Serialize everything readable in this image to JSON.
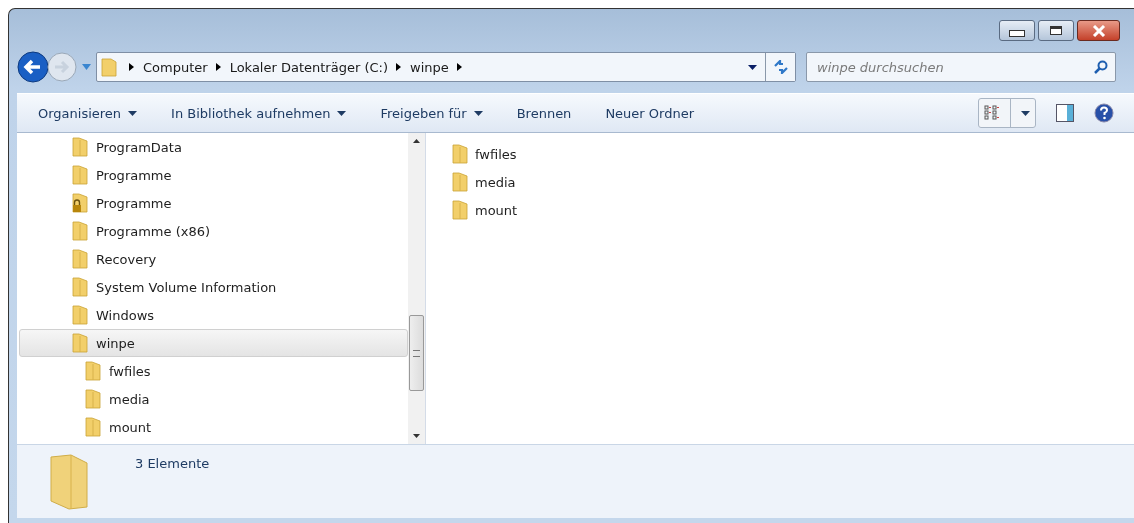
{
  "address": {
    "crumbs": [
      "Computer",
      "Lokaler Datenträger (C:)",
      "winpe"
    ]
  },
  "search": {
    "placeholder": "winpe durchsuchen"
  },
  "toolbar": [
    {
      "label": "Organisieren",
      "dropdown": true
    },
    {
      "label": "In Bibliothek aufnehmen",
      "dropdown": true
    },
    {
      "label": "Freigeben für",
      "dropdown": true
    },
    {
      "label": "Brennen",
      "dropdown": false
    },
    {
      "label": "Neuer Ordner",
      "dropdown": false
    }
  ],
  "tree": [
    {
      "name": "ProgramData",
      "locked": false,
      "selected": false
    },
    {
      "name": "Programme",
      "locked": false,
      "selected": false
    },
    {
      "name": "Programme",
      "locked": true,
      "selected": false
    },
    {
      "name": "Programme (x86)",
      "locked": false,
      "selected": false
    },
    {
      "name": "Recovery",
      "locked": false,
      "selected": false
    },
    {
      "name": "System Volume Information",
      "locked": false,
      "selected": false
    },
    {
      "name": "Windows",
      "locked": false,
      "selected": false
    },
    {
      "name": "winpe",
      "locked": false,
      "selected": true,
      "children": [
        {
          "name": "fwfiles",
          "locked": false,
          "selected": false
        },
        {
          "name": "media",
          "locked": false,
          "selected": false
        },
        {
          "name": "mount",
          "locked": false,
          "selected": false
        }
      ]
    }
  ],
  "files": [
    {
      "name": "fwfiles"
    },
    {
      "name": "media"
    },
    {
      "name": "mount"
    }
  ],
  "status": {
    "text": "3 Elemente"
  }
}
